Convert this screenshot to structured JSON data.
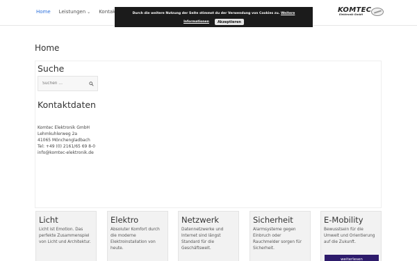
{
  "nav": {
    "items": [
      {
        "label": "Home",
        "active": true
      },
      {
        "label": "Leistungen",
        "dropdown": true
      },
      {
        "label": "Kontakt",
        "active": false
      }
    ]
  },
  "logo": {
    "text": "KOMTEC",
    "sub": "Elektronik GmbH"
  },
  "cookie": {
    "message": "Durch die weitere Nutzung der Seite stimmst du der Verwendung von Cookies zu.",
    "more_link": "Weitere",
    "info_link": "Informationen",
    "accept_label": "Akzeptieren"
  },
  "page": {
    "title": "Home"
  },
  "search": {
    "title": "Suche",
    "placeholder": "Suchen …"
  },
  "kontakt": {
    "title": "Kontaktdaten",
    "lines": [
      "Komtec Elektronik GmbH",
      "Lehmkuhlerweg 2a",
      "41065 Mönchengladbach",
      "Tel: +49 (0) 2161/65 69 8-0",
      "info@komtec-elektronik.de"
    ]
  },
  "cards": [
    {
      "title": "Licht",
      "text": "Licht ist Emotion. Das perfekte Zusammenspiel von Licht und Architektur."
    },
    {
      "title": "Elektro",
      "text": "Absoluter Komfort durch die moderne Elektroinstallation von heute."
    },
    {
      "title": "Netzwerk",
      "text": "Datennetzwerke und Internet sind längst Standard für die Geschäftswelt."
    },
    {
      "title": "Sicherheit",
      "text": "Alarmsysteme gegen Einbruch oder Rauchmelder sorgen für Sicherheit."
    },
    {
      "title": "E-Mobility",
      "text": "Bewusstsein für die Umwelt und Orientierung auf die Zukunft.",
      "button": "weiterlesen"
    }
  ],
  "colors": {
    "accent": "#2a6fdb",
    "cookie_bg": "#1b1b1b",
    "button_bg": "#2d1b6b"
  }
}
